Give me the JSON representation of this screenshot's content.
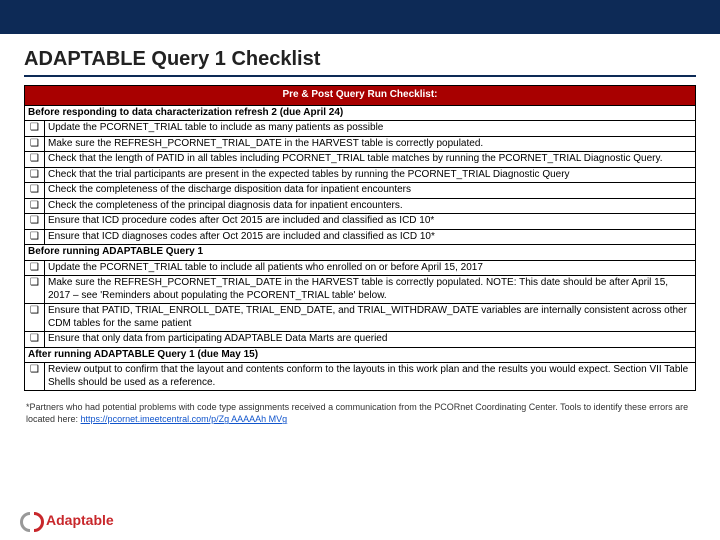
{
  "header": {
    "title": "ADAPTABLE Query 1 Checklist"
  },
  "checklist": {
    "table_header": "Pre & Post Query Run Checklist:",
    "section1": {
      "label": "Before responding to data characterization refresh 2 (due April 24)",
      "items": [
        "Update the PCORNET_TRIAL table to include as many patients as possible",
        "Make sure the REFRESH_PCORNET_TRIAL_DATE in the HARVEST table is correctly populated.",
        "Check that the length of PATID in all tables including PCORNET_TRIAL table matches by running the PCORNET_TRIAL Diagnostic Query.",
        "Check that the trial participants are present in the expected tables by running the PCORNET_TRIAL Diagnostic Query",
        "Check the completeness of the discharge disposition data for inpatient encounters",
        "Check the completeness of the principal diagnosis data for inpatient encounters.",
        "Ensure that ICD procedure codes after Oct 2015 are included and classified as ICD 10*",
        "Ensure that ICD diagnoses codes after Oct 2015 are included and classified as ICD 10*"
      ]
    },
    "section2": {
      "label": "Before running ADAPTABLE Query 1",
      "items": [
        "Update the PCORNET_TRIAL table to include all patients who enrolled on or before April 15, 2017",
        "Make sure the REFRESH_PCORNET_TRIAL_DATE in the HARVEST table is correctly populated. NOTE: This date should be after April 15, 2017 – see 'Reminders about populating the PCORENT_TRIAL table' below.",
        "Ensure that PATID, TRIAL_ENROLL_DATE, TRIAL_END_DATE, and TRIAL_WITHDRAW_DATE variables are internally consistent across other CDM tables for the same patient",
        "Ensure that only data from participating ADAPTABLE Data Marts are queried"
      ]
    },
    "section3": {
      "label": "After running ADAPTABLE Query 1 (due May 15)",
      "items": [
        "Review output to confirm that the layout and contents conform to the layouts in this work plan and the results you would expect.  Section VII Table Shells should be used as a reference."
      ]
    }
  },
  "footnote": {
    "text": "*Partners who had potential problems with code type assignments received a communication from the PCORnet Coordinating Center. Tools to identify these errors are located here: ",
    "link_text": "https://pcornet.imeetcentral.com/p/Zg AAAAAh MVg"
  },
  "footer": {
    "brand": "Adaptable"
  },
  "glyphs": {
    "checkbox": "❑"
  }
}
